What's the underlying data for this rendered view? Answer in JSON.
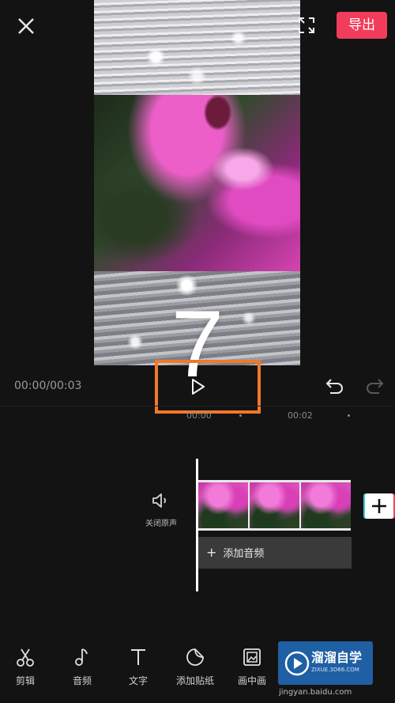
{
  "topbar": {
    "export_label": "导出"
  },
  "player": {
    "overlay_number": "7",
    "time_display": "00:00/00:03"
  },
  "ruler": {
    "tick_0": "00:00",
    "tick_2": "00:02"
  },
  "track": {
    "mute_label": "关闭原声",
    "add_audio_label": "添加音频",
    "add_audio_plus": "+"
  },
  "toolbar": {
    "items": [
      {
        "label": "剪辑",
        "icon": "scissors-icon"
      },
      {
        "label": "音频",
        "icon": "music-note-icon"
      },
      {
        "label": "文字",
        "icon": "text-icon"
      },
      {
        "label": "添加贴纸",
        "icon": "sticker-icon"
      },
      {
        "label": "画中画",
        "icon": "picture-in-picture-icon"
      }
    ]
  },
  "watermark": {
    "title": "溜溜自学",
    "subtitle": "ZIXUE.3D66.COM",
    "url": "jingyan.baidu.com"
  },
  "colors": {
    "accent": "#f23c5b",
    "highlight_box": "#f0792a",
    "background": "#131313"
  }
}
